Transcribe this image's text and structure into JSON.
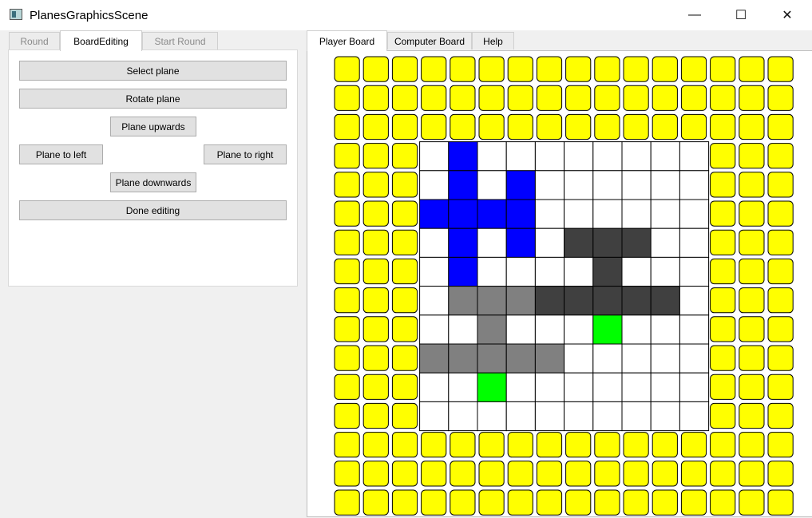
{
  "window": {
    "title": "PlanesGraphicsScene",
    "controls": {
      "minimize": "—",
      "maximize": "☐",
      "close": "✕"
    }
  },
  "left_tabs": [
    {
      "label": "Round",
      "state": "disabled"
    },
    {
      "label": "BoardEditing",
      "state": "active"
    },
    {
      "label": "Start Round",
      "state": "disabled"
    }
  ],
  "buttons": {
    "select_plane": "Select plane",
    "rotate_plane": "Rotate plane",
    "plane_upwards": "Plane upwards",
    "plane_to_left": "Plane to left",
    "plane_to_right": "Plane to right",
    "plane_downwards": "Plane downwards",
    "done_editing": "Done editing"
  },
  "right_tabs": [
    {
      "label": "Player Board",
      "state": "active"
    },
    {
      "label": "Computer Board",
      "state": "normal"
    },
    {
      "label": "Help",
      "state": "normal"
    }
  ],
  "board": {
    "outer_cols": 16,
    "outer_rows": 16,
    "inner_cols": 10,
    "inner_rows": 10,
    "inner_offset_col": 3,
    "inner_offset_row": 3,
    "colors": {
      "pad": "#ffff00",
      "empty": "#ffffff",
      "blue_plane": "#0000ff",
      "dark_plane": "#404040",
      "gray_plane": "#808080",
      "head": "#00ff00"
    },
    "cells": [
      "WBWWWWWWWW",
      "WBWBWWWWWW",
      "BBBBWWWWWW",
      "WBWBWDDDWW",
      "WBWWWWDWWW",
      "WGGGDDDDDW",
      "WWGWWWHWWW",
      "GGGGGWWWWW",
      "WWHWWWWWWW",
      "WWWWWWWWWW"
    ]
  }
}
